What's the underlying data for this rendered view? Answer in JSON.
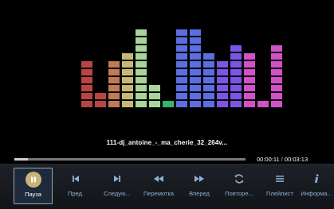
{
  "player": {
    "track_title": "111-dj_antoine_-_ma_cherie_32_264v...",
    "elapsed": "00:00:11",
    "separator": "/",
    "duration": "00:03:13",
    "progress": 0.057
  },
  "visualizer": {
    "cell_colors": [
      "#b84545",
      "#c07a58",
      "#c8b878",
      "#a9d49a",
      "#30b86b",
      "#5c6fe0",
      "#7d55e6",
      "#d052c6"
    ],
    "levels": [
      6,
      2,
      6,
      7,
      10,
      3,
      1,
      10,
      10,
      7,
      6,
      8,
      7,
      1,
      8
    ]
  },
  "controls": [
    {
      "id": "pause",
      "label": "Пауза",
      "icon": "pause-icon",
      "selected": true
    },
    {
      "id": "prev",
      "label": "Пред.",
      "icon": "previous-track-icon"
    },
    {
      "id": "next",
      "label": "Следую...",
      "icon": "next-track-icon"
    },
    {
      "id": "rewind",
      "label": "Перемотка",
      "icon": "rewind-icon"
    },
    {
      "id": "forward",
      "label": "Вперед",
      "icon": "fast-forward-icon"
    },
    {
      "id": "repeat",
      "label": "Повторе...",
      "icon": "repeat-icon"
    },
    {
      "id": "playlist",
      "label": "Плейлист",
      "icon": "playlist-icon"
    },
    {
      "id": "info",
      "label": "Информа...",
      "icon": "info-icon"
    }
  ],
  "colors": {
    "icon": "#8fb1d6",
    "pause_circle": "#c9b27a",
    "label_text": "#8fb1d6"
  }
}
